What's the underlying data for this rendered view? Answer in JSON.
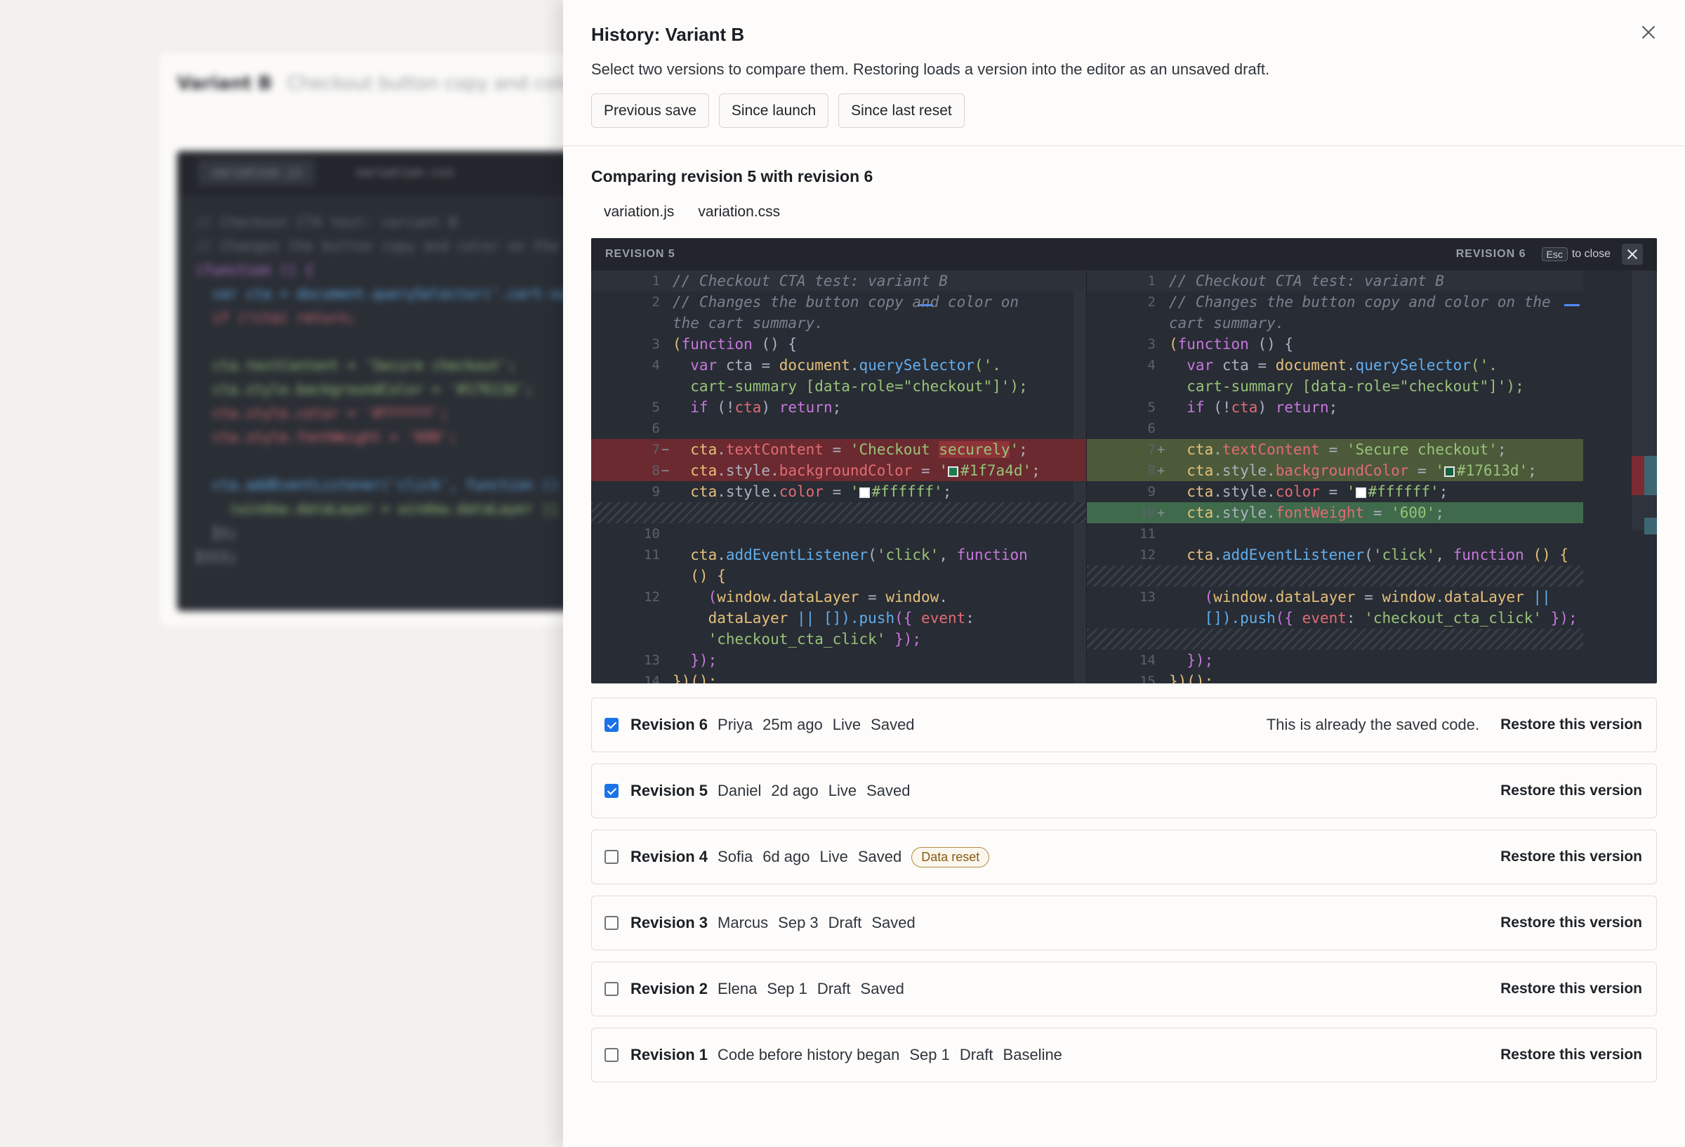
{
  "background": {
    "title": "Variant B",
    "subtitle": "Checkout button copy and color",
    "tabs": [
      "variation.js",
      "variation.css"
    ],
    "lines": [
      "// Checkout CTA test: variant B",
      "// Changes the button copy and color on the",
      "(function () {",
      "  var cta = document.querySelector('.cart-su",
      "  if (!cta) return;",
      "",
      "  cta.textContent = 'Secure checkout';",
      "  cta.style.backgroundColor = '#17613d';",
      "  cta.style.color = '#ffffff';",
      "  cta.style.fontWeight = '600';",
      "",
      "  cta.addEventListener('click', function () {",
      "    (window.dataLayer = window.dataLayer ||",
      "  });",
      "})();"
    ]
  },
  "modal": {
    "title": "History: Variant B",
    "subtitle": "Select two versions to compare them. Restoring loads a version into the editor as an unsaved draft.",
    "presets": [
      "Previous save",
      "Since launch",
      "Since last reset"
    ],
    "compare_title": "Comparing revision 5 with revision 6",
    "file_tabs": [
      "variation.js",
      "variation.css"
    ]
  },
  "diff": {
    "left_label": "REVISION 5",
    "right_label": "REVISION 6",
    "esc_key": "Esc",
    "esc_text": "to close",
    "colors": {
      "removed": "#6b2a2f",
      "added": "#4c5a3a",
      "added_line": "#3f6a4b",
      "background": "#282c34"
    },
    "swatch_colors": {
      "old_bg": "#1f7a4d",
      "new_bg": "#17613d",
      "text": "#ffffff"
    },
    "left_lines": [
      "1",
      "2",
      "",
      "3",
      "4",
      "",
      "5",
      "6",
      "7",
      "8",
      "9",
      "",
      "10",
      "11",
      "",
      "12",
      "",
      "",
      "13",
      "14"
    ],
    "left_markers": {
      "7": "−",
      "8": "−"
    },
    "right_lines": [
      "1",
      "2",
      "",
      "3",
      "4",
      "",
      "5",
      "6",
      "7",
      "8",
      "9",
      "10",
      "11",
      "12",
      "",
      "13",
      "",
      "",
      "14",
      "15"
    ],
    "right_markers": {
      "7": "+",
      "8": "+",
      "10": "+"
    },
    "left": {
      "l1": "// Checkout CTA test: variant B",
      "l2a": "// Changes the button copy and color on",
      "l2b": "the cart summary.",
      "l3a": "(",
      "l3b": "function",
      "l3c": " () {",
      "l4a": "  var ",
      "l4b": "cta",
      "l4c": " = ",
      "l4d": "document",
      "l4e": ".",
      "l4f": "querySelector",
      "l4g": "('.",
      "l4h": "  cart-summary [data-role=\"checkout\"]');",
      "l5a": "  if",
      "l5b": " (!",
      "l5c": "cta",
      "l5d": ") ",
      "l5e": "return",
      "l5f": ";",
      "l7a": "  cta",
      "l7b": ".",
      "l7c": "textContent",
      "l7d": " = ",
      "l7e": "'Checkout ",
      "l7f": "securely",
      "l7g": "'",
      "l7h": ";",
      "l8a": "  cta",
      "l8b": ".style.",
      "l8c": "backgroundColor",
      "l8d": " = ",
      "l8e": "'",
      "l8f": "#1f7a4d'",
      "l8g": ";",
      "l9a": "  cta",
      "l9b": ".style.",
      "l9c": "color",
      "l9d": " = ",
      "l9e": "'",
      "l9f": "#ffffff'",
      "l9g": ";",
      "l11a": "  cta",
      "l11b": ".",
      "l11c": "addEventListener",
      "l11d": "(",
      "l11e": "'click'",
      "l11f": ", ",
      "l11g": "function",
      "l11h": "  () {",
      "l12a": "    (",
      "l12b": "window",
      "l12c": ".",
      "l12d": "dataLayer",
      "l12e": " = ",
      "l12f": "window",
      "l12g": ".",
      "l12h": "    dataLayer",
      "l12i": " || ",
      "l12j": "[]).",
      "l12k": "push",
      "l12l": "({ ",
      "l12m": "event",
      "l12n": ":",
      "l12o": "    'checkout_cta_click'",
      "l12p": " });",
      "l13": "  });",
      "l14": "})();"
    },
    "right": {
      "l1": "// Checkout CTA test: variant B",
      "l2a": "// Changes the button copy and color on the",
      "l2b": "cart summary.",
      "l3a": "(",
      "l3b": "function",
      "l3c": " () {",
      "l4a": "  var ",
      "l4b": "cta",
      "l4c": " = ",
      "l4d": "document",
      "l4e": ".",
      "l4f": "querySelector",
      "l4g": "('.",
      "l4h": "  cart-summary [data-role=\"checkout\"]');",
      "l5a": "  if",
      "l5b": " (!",
      "l5c": "cta",
      "l5d": ") ",
      "l5e": "return",
      "l5f": ";",
      "l7a": "  cta",
      "l7b": ".",
      "l7c": "textContent",
      "l7d": " = ",
      "l7e": "'Secure checkout'",
      "l7f": ";",
      "l8a": "  cta",
      "l8b": ".style.",
      "l8c": "backgroundColor",
      "l8d": " = ",
      "l8e": "'",
      "l8f": "#17613d'",
      "l8g": ";",
      "l9a": "  cta",
      "l9b": ".style.",
      "l9c": "color",
      "l9d": " = ",
      "l9e": "'",
      "l9f": "#ffffff'",
      "l9g": ";",
      "l10a": "  cta",
      "l10b": ".style.",
      "l10c": "fontWeight",
      "l10d": " = ",
      "l10e": "'600'",
      "l10f": ";",
      "l12a": "  cta",
      "l12b": ".",
      "l12c": "addEventListener",
      "l12d": "(",
      "l12e": "'click'",
      "l12f": ", ",
      "l12g": "function",
      "l12h": " () {",
      "l13a": "    (",
      "l13b": "window",
      "l13c": ".",
      "l13d": "dataLayer",
      "l13e": " = ",
      "l13f": "window",
      "l13g": ".",
      "l13h": "dataLayer",
      "l13i": " ||",
      "l13j": "    []).",
      "l13k": "push",
      "l13l": "({ ",
      "l13m": "event",
      "l13n": ": ",
      "l13o": "'checkout_cta_click'",
      "l13p": " });",
      "l14": "  });",
      "l15": "})();"
    }
  },
  "revisions": [
    {
      "name": "Revision 6",
      "author": "Priya",
      "time": "25m ago",
      "env": "Live",
      "state": "Saved",
      "checked": true,
      "note": "This is already the saved code.",
      "action": "Restore this version"
    },
    {
      "name": "Revision 5",
      "author": "Daniel",
      "time": "2d ago",
      "env": "Live",
      "state": "Saved",
      "checked": true,
      "action": "Restore this version"
    },
    {
      "name": "Revision 4",
      "author": "Sofia",
      "time": "6d ago",
      "env": "Live",
      "state": "Saved",
      "checked": false,
      "badge": "Data reset",
      "action": "Restore this version"
    },
    {
      "name": "Revision 3",
      "author": "Marcus",
      "time": "Sep 3",
      "env": "Draft",
      "state": "Saved",
      "checked": false,
      "action": "Restore this version"
    },
    {
      "name": "Revision 2",
      "author": "Elena",
      "time": "Sep 1",
      "env": "Draft",
      "state": "Saved",
      "checked": false,
      "action": "Restore this version"
    },
    {
      "name": "Revision 1",
      "author": "Code before history began",
      "time": "Sep 1",
      "env": "Draft",
      "state": "Baseline",
      "checked": false,
      "action": "Restore this version"
    }
  ]
}
